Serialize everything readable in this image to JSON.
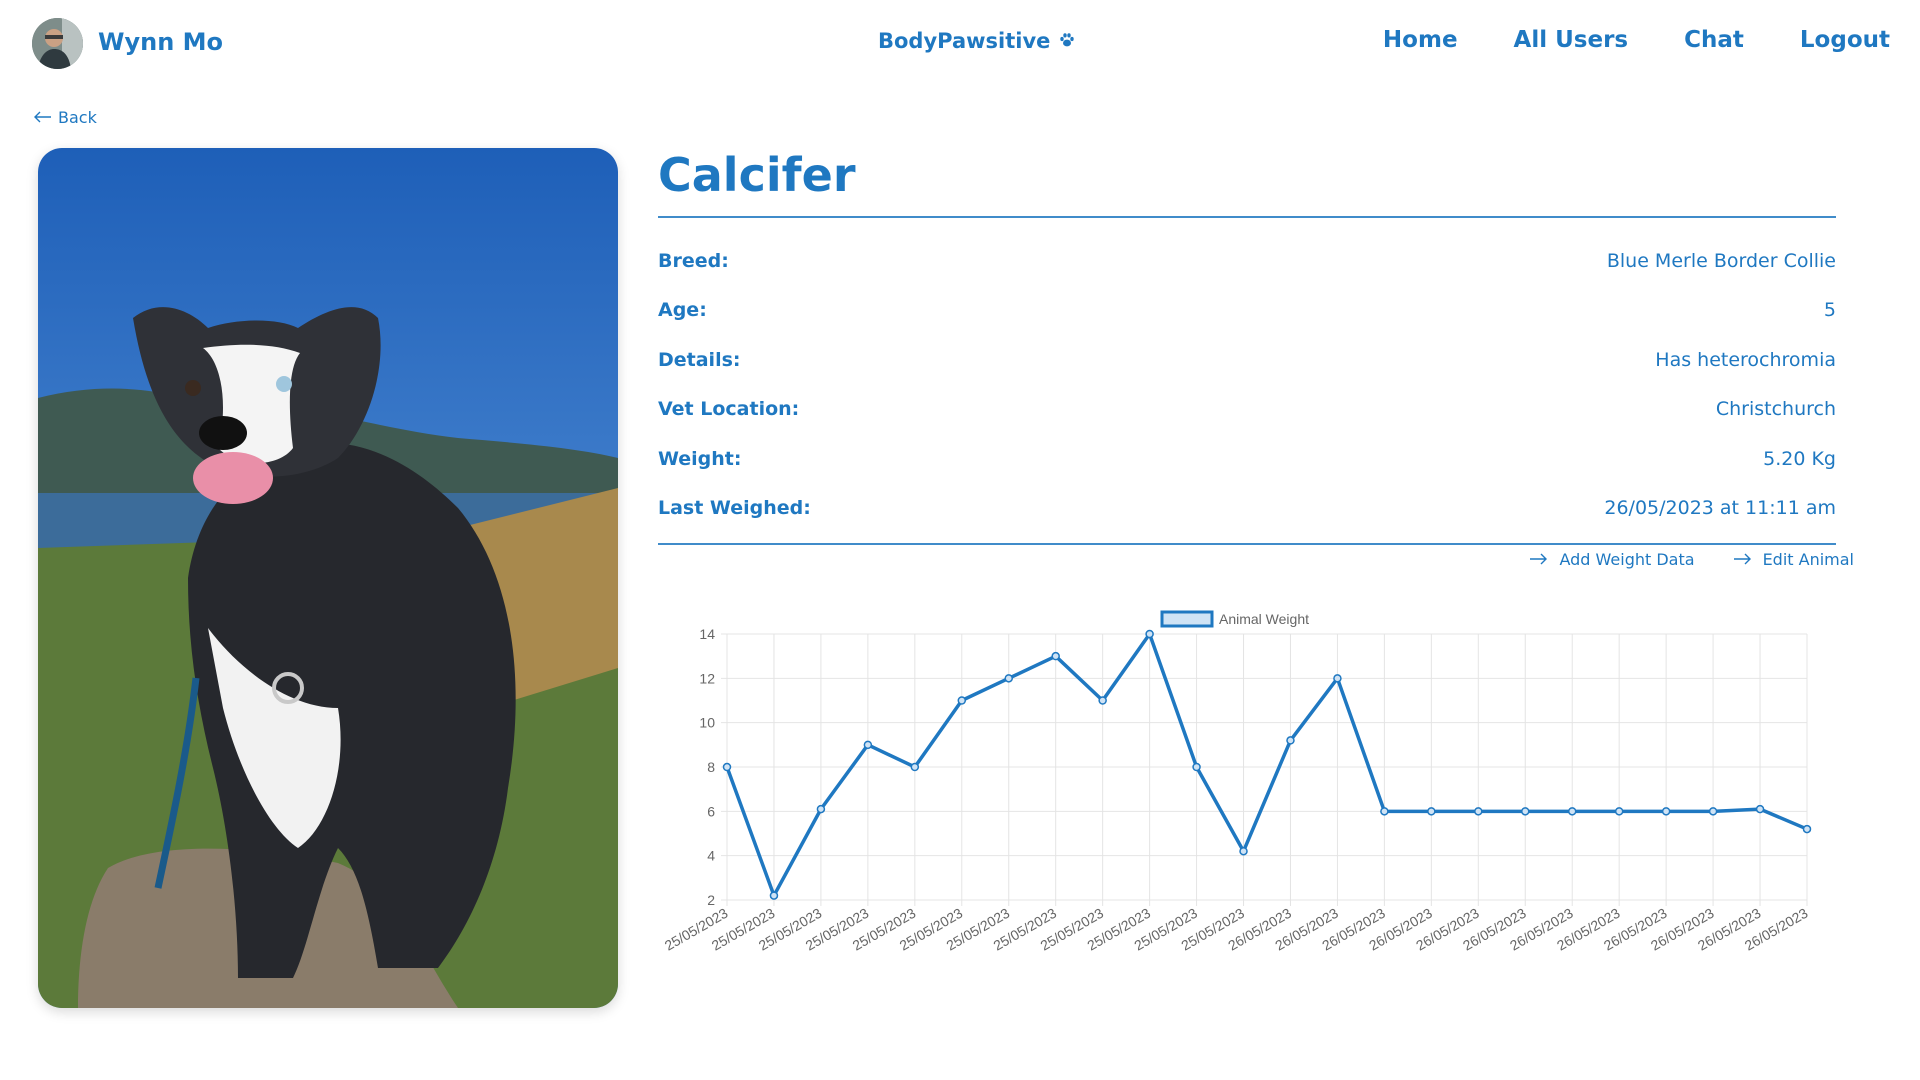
{
  "nav": {
    "username": "Wynn Mo",
    "brand": "BodyPawsitive",
    "links": [
      "Home",
      "All Users",
      "Chat",
      "Logout"
    ]
  },
  "back_label": "Back",
  "animal": {
    "name": "Calcifer",
    "fields": [
      {
        "label": "Breed:",
        "value": "Blue Merle Border Collie"
      },
      {
        "label": "Age:",
        "value": "5"
      },
      {
        "label": "Details:",
        "value": "Has heterochromia"
      },
      {
        "label": "Vet Location:",
        "value": "Christchurch"
      },
      {
        "label": "Weight:",
        "value": "5.20 Kg"
      },
      {
        "label": "Last Weighed:",
        "value": "26/05/2023 at 11:11 am"
      }
    ]
  },
  "actions": {
    "add_weight": "Add Weight Data",
    "edit_animal": "Edit Animal"
  },
  "colors": {
    "primary": "#1f78c1",
    "legend_fill": "#cfe3f5",
    "grid": "#e4e4e4",
    "tick": "#666666"
  },
  "chart_data": {
    "type": "line",
    "x": [
      "25/05/2023",
      "25/05/2023",
      "25/05/2023",
      "25/05/2023",
      "25/05/2023",
      "25/05/2023",
      "25/05/2023",
      "25/05/2023",
      "25/05/2023",
      "25/05/2023",
      "25/05/2023",
      "25/05/2023",
      "26/05/2023",
      "26/05/2023",
      "26/05/2023",
      "26/05/2023",
      "26/05/2023",
      "26/05/2023",
      "26/05/2023",
      "26/05/2023",
      "26/05/2023",
      "26/05/2023",
      "26/05/2023",
      "26/05/2023"
    ],
    "series": [
      {
        "name": "Animal Weight",
        "values": [
          8,
          2.2,
          6.1,
          9,
          8,
          11,
          12,
          13,
          11,
          14,
          8,
          4.2,
          9.2,
          12,
          6,
          6,
          6,
          6,
          6,
          6,
          6,
          6,
          6.1,
          5.2
        ]
      }
    ],
    "yticks": [
      2,
      4,
      6,
      8,
      10,
      12,
      14
    ],
    "ylim": [
      2,
      14
    ],
    "grid": true,
    "legend": "top-center"
  }
}
